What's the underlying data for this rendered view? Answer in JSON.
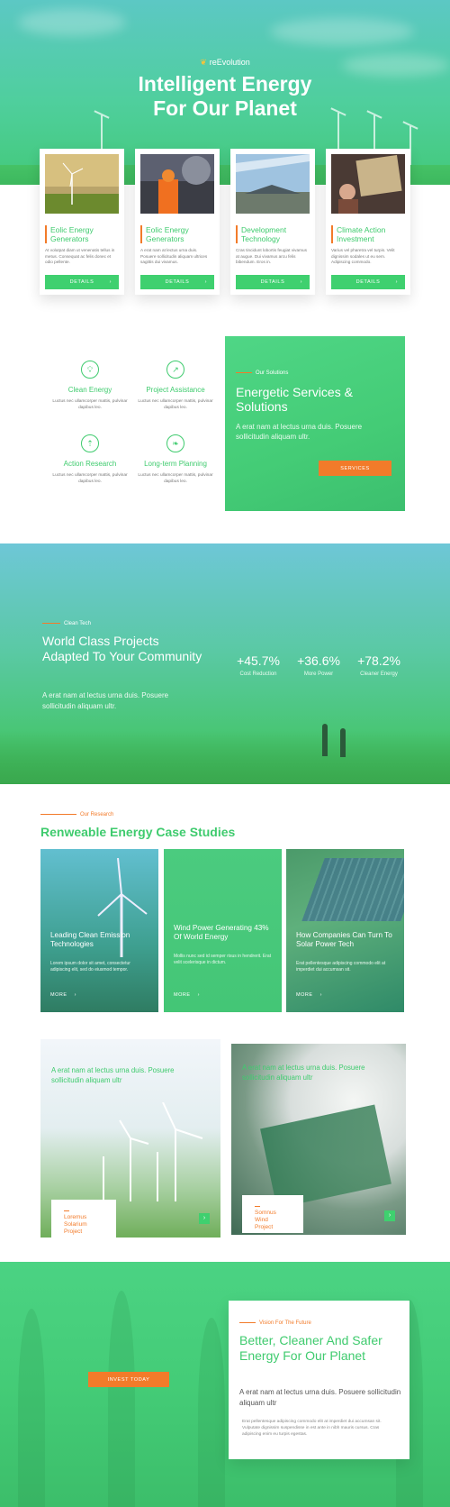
{
  "hero": {
    "brand": "reEvolution",
    "title_line1": "Intelligent Energy",
    "title_line2": "For Our Planet"
  },
  "cards": [
    {
      "title": "Eolic Energy Generators",
      "text": "At volutpat diam ut venenatis tellus in metus. Consequat ac felis donec et odio pellente.",
      "button": "DETAILS"
    },
    {
      "title": "Eolic Energy Generators",
      "text": "A erat nam at lectus urna duis. Posuere sollicitudin aliquam ultrices sagittis dui vivamus.",
      "button": "DETAILS"
    },
    {
      "title": "Development Technology",
      "text": "Cras tincidunt lobortis feugiat vivamus at augue. Dui vivamus arcu felis bibendum. Eros in.",
      "button": "DETAILS"
    },
    {
      "title": "Climate Action Investment",
      "text": "Varius vel pharetra vel turpis. Velit dignissim sodales ut eu sem. Adipiscing commodo.",
      "button": "DETAILS"
    }
  ],
  "features": [
    {
      "title": "Clean Energy",
      "text": "Luctus nec ullamcorper mattis, pulvinar dapibus leo.",
      "icon": "bulb-icon"
    },
    {
      "title": "Project Assistance",
      "text": "Luctus nec ullamcorper mattis, pulvinar dapibus leo.",
      "icon": "chart-icon"
    },
    {
      "title": "Action Research",
      "text": "Luctus nec ullamcorper mattis, pulvinar dapibus leo.",
      "icon": "plant-icon"
    },
    {
      "title": "Long-term Planning",
      "text": "Luctus nec ullamcorper mattis, pulvinar dapibus leo.",
      "icon": "leaf-icon"
    }
  ],
  "solutions": {
    "kicker": "Our Solutions",
    "title": "Energetic Services & Solutions",
    "text": "A erat nam at lectus urna duis. Posuere sollicitudin aliquam ultr.",
    "button": "SERVICES"
  },
  "projects": {
    "kicker": "Clean Tech",
    "title": "World Class Projects Adapted To Your Community",
    "text": "A erat nam at lectus urna duis. Posuere sollicitudin aliquam ultr.",
    "stats": [
      {
        "value": "+45.7%",
        "label": "Cost Reduction"
      },
      {
        "value": "+36.6%",
        "label": "More Power"
      },
      {
        "value": "+78.2%",
        "label": "Cleaner Energy"
      }
    ]
  },
  "research": {
    "kicker": "Our Research",
    "title": "Renweable Energy Case Studies",
    "cases": [
      {
        "title": "Leading Clean Emission Technologies",
        "text": "Lorem ipsum dolor sit amet, consectetur adipiscing elit, sed do eiusmod tempor.",
        "more": "MORE"
      },
      {
        "title": "Wind Power Generating 43% Of World Energy",
        "text": "Mollis nunc sed id semper risus in hendrerit. Erat velit scelerisque in dictum.",
        "more": "MORE"
      },
      {
        "title": "How Companies Can Turn To Solar Power Tech",
        "text": "Erat pellentesque adipiscing commodo elit at imperdiet dui accumsan sit.",
        "more": "MORE"
      }
    ]
  },
  "gallery": [
    {
      "quote": "A erat nam at lectus urna duis. Posuere sollicitudin aliquam ultr",
      "tag_line1": "Loremus",
      "tag_line2": "Solarium",
      "tag_line3": "Project"
    },
    {
      "quote": "A erat nam at lectus urna duis. Posuere sollicitudin aliquam ultr",
      "tag_line1": "Somnus",
      "tag_line2": "Wind",
      "tag_line3": "Project"
    }
  ],
  "vision": {
    "button": "INVEST TODAY",
    "kicker": "Vision For The Future",
    "title": "Better, Cleaner And Safer Energy For Our Planet",
    "lead": "A erat nam at lectus urna duis. Posuere sollicitudin aliquam ultr",
    "small": "Erat pellentesque adipiscing commodo elit at imperdiet dui accumsan sit. Vulputate dignissim suspendisse in est ante in nibh mauris cursus. Cras adipiscing enim eu turpis egestas."
  },
  "colors": {
    "green": "#3fcb6e",
    "orange": "#f27b2a"
  }
}
